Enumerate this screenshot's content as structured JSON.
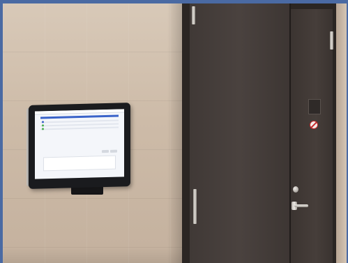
{
  "scene": {
    "door_sign_text": "",
    "colors": {
      "frame_blue": "#4a6aa3",
      "wall": "#cdbba8",
      "door": "#443c39",
      "tablet_bezel": "#1a1b1e",
      "tablet_screen": "#f4f6fa",
      "screen_accent": "#3a63c9",
      "no_sign_red": "#c8282a"
    },
    "icons": [
      "no-smoking-sign",
      "door-handle",
      "door-knob",
      "hinge"
    ]
  }
}
